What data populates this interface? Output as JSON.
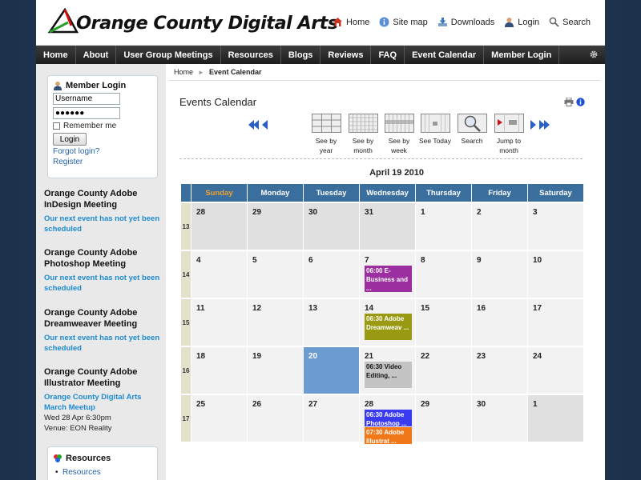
{
  "site": {
    "title": "Orange County Digital Arts"
  },
  "topnav": [
    {
      "label": "Home",
      "icon": "home-icon"
    },
    {
      "label": "Site map",
      "icon": "info-icon"
    },
    {
      "label": "Downloads",
      "icon": "download-icon"
    },
    {
      "label": "Login",
      "icon": "user-icon"
    },
    {
      "label": "Search",
      "icon": "search-icon"
    }
  ],
  "menu": [
    "Home",
    "About",
    "User Group Meetings",
    "Resources",
    "Blogs",
    "Reviews",
    "FAQ",
    "Event Calendar",
    "Member Login"
  ],
  "breadcrumb": {
    "home": "Home",
    "current": "Event Calendar"
  },
  "login": {
    "title": "Member Login",
    "username_value": "Username",
    "password_value": "●●●●●●",
    "remember_label": "Remember me",
    "button_label": "Login",
    "forgot_label": "Forgot login?",
    "register_label": "Register"
  },
  "meetings": [
    {
      "title": "Orange County Adobe InDesign Meeting",
      "note": "Our next event has not yet been scheduled"
    },
    {
      "title": "Orange County Adobe Photoshop Meeting",
      "note": "Our next event has not yet been scheduled"
    },
    {
      "title": "Orange County Adobe Dreamweaver Meeting",
      "note": "Our next event has not yet been scheduled"
    },
    {
      "title": "Orange County Adobe Illustrator Meeting",
      "note": "Orange County Digital Arts March Meetup",
      "date": "Wed 28 Apr 6:30pm",
      "venue": "Venue: EON Reality"
    }
  ],
  "resources": {
    "title": "Resources",
    "items": [
      "Resources"
    ]
  },
  "calendar": {
    "page_title": "Events Calendar",
    "month_title": "April 19 2010",
    "tools": [
      {
        "label": "See by year"
      },
      {
        "label": "See by month"
      },
      {
        "label": "See by week"
      },
      {
        "label": "See Today"
      },
      {
        "label": "Search"
      },
      {
        "label": "Jump to month"
      }
    ],
    "days": [
      "Sunday",
      "Monday",
      "Tuesday",
      "Wednesday",
      "Thursday",
      "Friday",
      "Saturday"
    ],
    "weeks": [
      {
        "num": "13",
        "days": [
          {
            "d": "28",
            "out": true
          },
          {
            "d": "29",
            "out": true
          },
          {
            "d": "30",
            "out": true
          },
          {
            "d": "31",
            "out": true
          },
          {
            "d": "1"
          },
          {
            "d": "2"
          },
          {
            "d": "3"
          }
        ]
      },
      {
        "num": "14",
        "days": [
          {
            "d": "4"
          },
          {
            "d": "5"
          },
          {
            "d": "6"
          },
          {
            "d": "7",
            "events": [
              {
                "text": "06:00 E-Business and ...",
                "color": "#9b2fa0"
              }
            ]
          },
          {
            "d": "8"
          },
          {
            "d": "9"
          },
          {
            "d": "10"
          }
        ]
      },
      {
        "num": "15",
        "days": [
          {
            "d": "11"
          },
          {
            "d": "12"
          },
          {
            "d": "13"
          },
          {
            "d": "14",
            "events": [
              {
                "text": "06:30 Adobe Dreamweav ...",
                "color": "#9a9a12"
              }
            ]
          },
          {
            "d": "15"
          },
          {
            "d": "16"
          },
          {
            "d": "17"
          }
        ]
      },
      {
        "num": "16",
        "days": [
          {
            "d": "18"
          },
          {
            "d": "19"
          },
          {
            "d": "20",
            "today": true
          },
          {
            "d": "21",
            "events": [
              {
                "text": "06:30 Video Editing, ...",
                "color": "#c4c4c4"
              }
            ]
          },
          {
            "d": "22"
          },
          {
            "d": "23"
          },
          {
            "d": "24"
          }
        ]
      },
      {
        "num": "17",
        "days": [
          {
            "d": "25"
          },
          {
            "d": "26"
          },
          {
            "d": "27"
          },
          {
            "d": "28",
            "events": [
              {
                "text": "06:30 Adobe Photoshop ...",
                "color": "#3a3af0"
              },
              {
                "text": "07:30 Adobe Illustrat ...",
                "color": "#f07818"
              }
            ]
          },
          {
            "d": "29"
          },
          {
            "d": "30"
          },
          {
            "d": "1",
            "out": true
          }
        ]
      }
    ]
  }
}
